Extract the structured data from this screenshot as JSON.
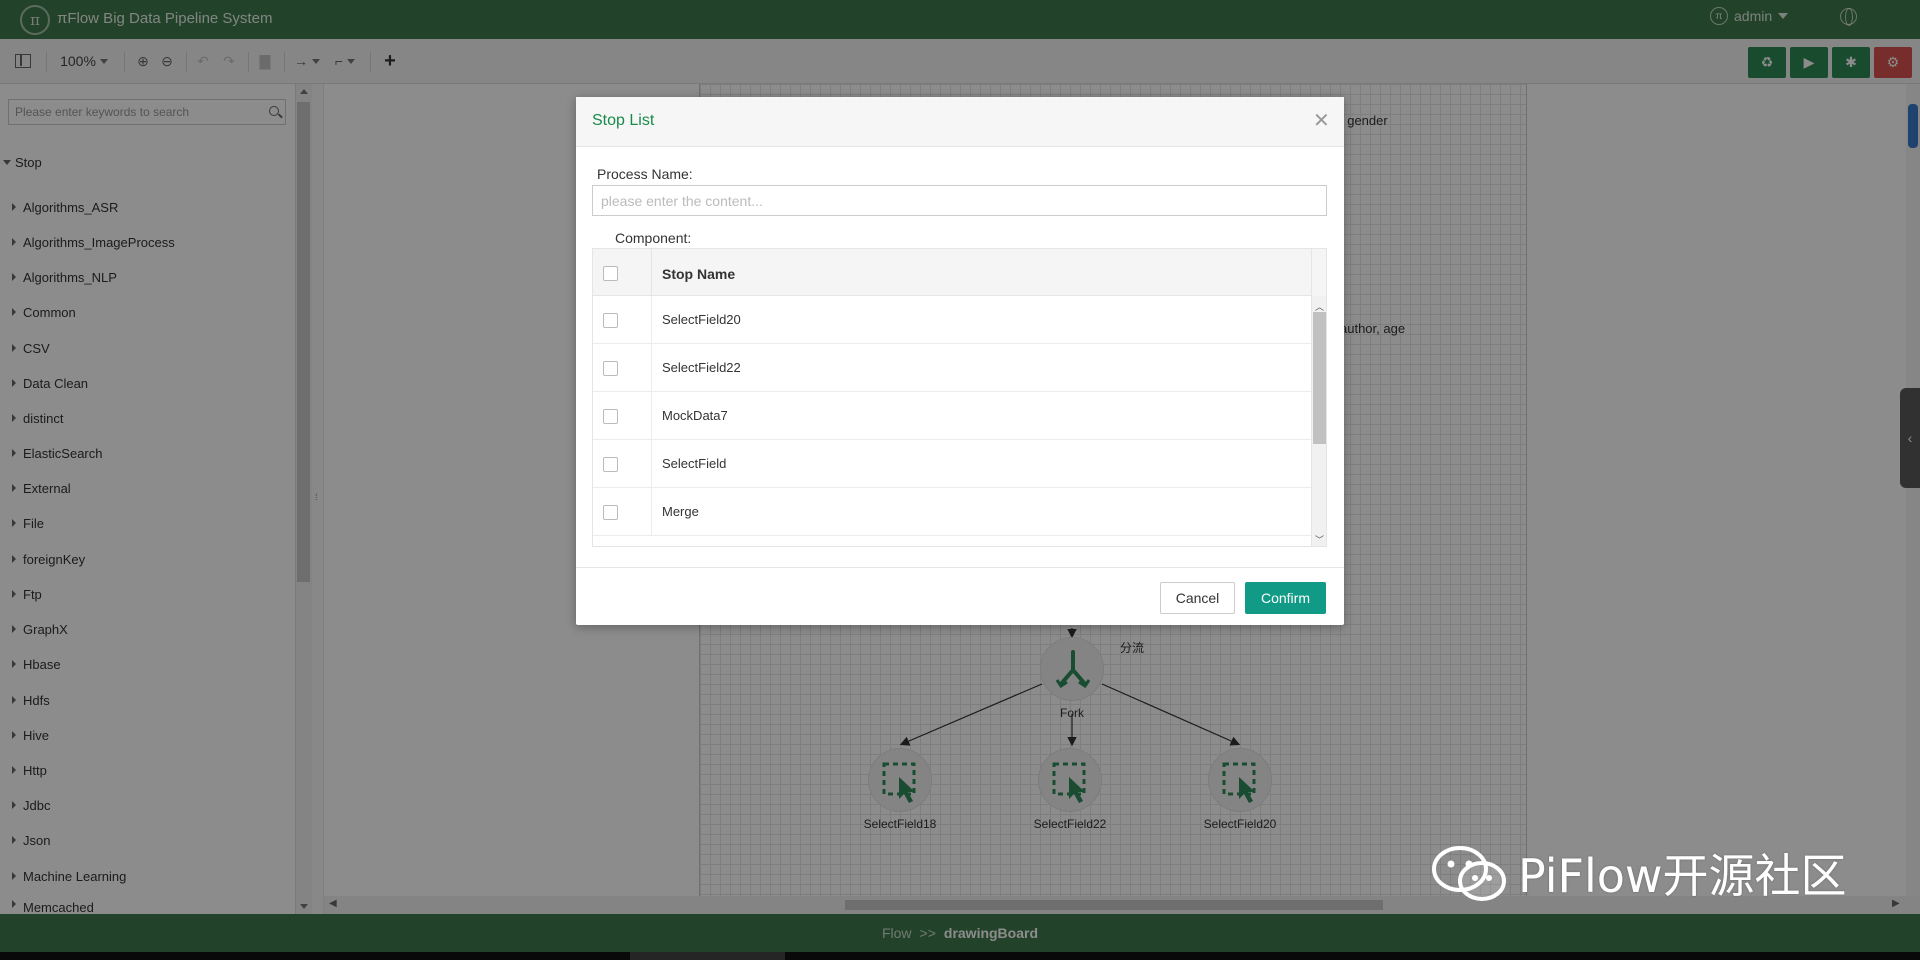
{
  "app": {
    "title": "πFlow Big Data Pipeline System",
    "user": "admin"
  },
  "toolbar": {
    "zoom": "100%"
  },
  "sidebar": {
    "search_placeholder": "Please enter keywords to search",
    "root": "Stop",
    "items": [
      "Algorithms_ASR",
      "Algorithms_ImageProcess",
      "Algorithms_NLP",
      "Common",
      "CSV",
      "Data Clean",
      "distinct",
      "ElasticSearch",
      "External",
      "File",
      "foreignKey",
      "Ftp",
      "GraphX",
      "Hbase",
      "Hdfs",
      "Hive",
      "Http",
      "Jdbc",
      "Json",
      "Machine Learning",
      "Memcached"
    ]
  },
  "canvas": {
    "labels": {
      "top_right_1": ", gender",
      "top_right_2": "author, age",
      "fork_note": "分流"
    },
    "nodes": {
      "fork": "Fork",
      "sf18": "SelectField18",
      "sf22": "SelectField22",
      "sf20": "SelectField20"
    }
  },
  "breadcrumb": {
    "root": "Flow",
    "sep": ">>",
    "current": "drawingBoard"
  },
  "modal": {
    "title": "Stop List",
    "process_label": "Process Name:",
    "process_placeholder": "please enter the content...",
    "component_label": "Component:",
    "column_header": "Stop Name",
    "rows": [
      "SelectField20",
      "SelectField22",
      "MockData7",
      "SelectField",
      "Merge"
    ],
    "cancel": "Cancel",
    "confirm": "Confirm"
  },
  "watermark": {
    "text": "PiFlow开源社区"
  },
  "colors": {
    "header": "#3e7a4b",
    "title_green": "#1a8a4a",
    "confirm": "#119b86",
    "danger": "#d9534f"
  }
}
